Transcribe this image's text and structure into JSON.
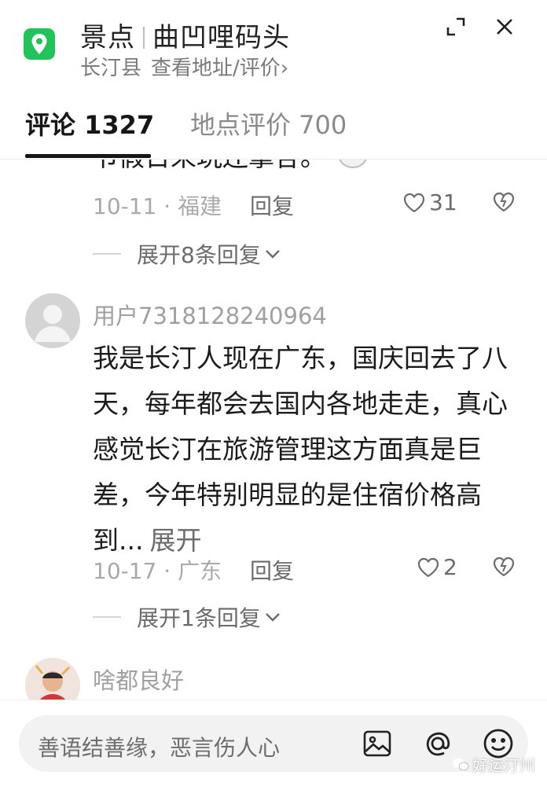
{
  "header": {
    "category": "景点",
    "place_name": "曲凹哩码头",
    "county": "长汀县",
    "address_link": "查看地址/评价",
    "chevron": "›",
    "expand_icon": "expand-icon",
    "close_icon": "close-icon",
    "pin_color": "#22c35a"
  },
  "tabs": [
    {
      "label": "评论 1327",
      "active": true
    },
    {
      "label": "地点评价 700",
      "active": false
    }
  ],
  "comments": [
    {
      "partial_text": "节假日来玩还挚各。",
      "date_region": "10-11 · 福建",
      "reply_label": "回复",
      "likes": "31",
      "expand_label": "展开8条回复"
    },
    {
      "user": "用户7318128240964",
      "text": "我是长汀人现在广东，国庆回去了八天，每年都会去国内各地走走，真心感觉长汀在旅游管理这方面真是巨差，今年特别明显的是住宿价格高到...",
      "more_label": "展开",
      "date_region": "10-17 · 广东",
      "reply_label": "回复",
      "likes": "2",
      "expand_label": "展开1条回复"
    },
    {
      "user": "啥都良好"
    }
  ],
  "composer": {
    "placeholder": "善语结善缘，恶言伤人心",
    "image_icon": "image-icon",
    "mention_icon": "at-icon",
    "emoji_icon": "emoji-icon"
  },
  "watermark": "好运汀州"
}
